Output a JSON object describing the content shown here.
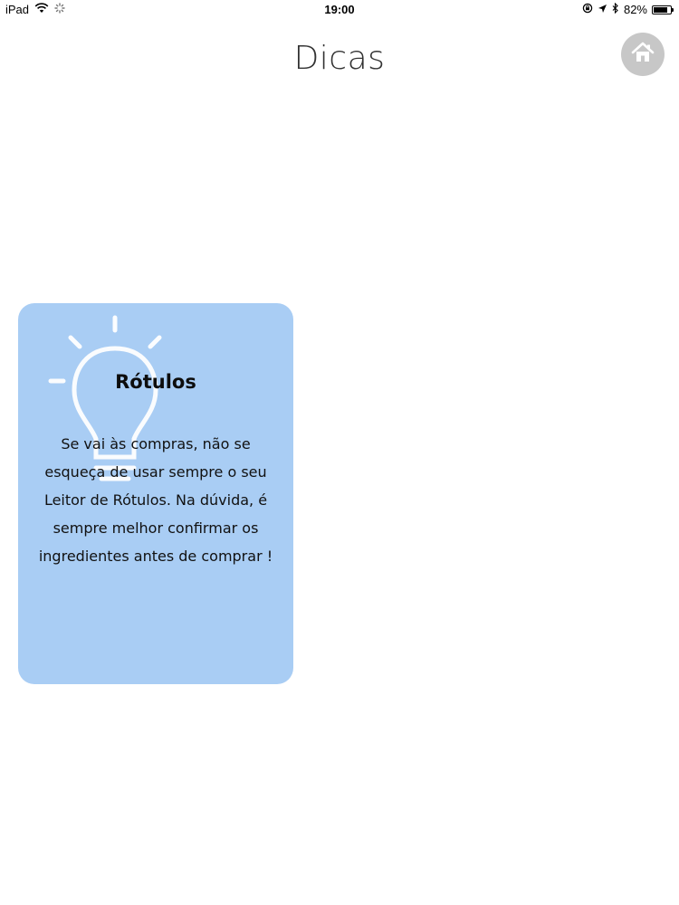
{
  "status_bar": {
    "device": "iPad",
    "time": "19:00",
    "battery_percent": "82%",
    "battery_level": 0.82
  },
  "header": {
    "title": "Dicas"
  },
  "tip": {
    "title": "Rótulos",
    "body": "Se vai às compras, não se esqueça de usar sempre o seu Leitor de Rótulos. Na dúvida, é sempre melhor confirmar os ingredientes antes de comprar !"
  },
  "colors": {
    "card_background": "#a9cdf4",
    "home_button": "#c7c7c7"
  },
  "icons": {
    "home": "home-icon",
    "bulb": "lightbulb-icon"
  }
}
